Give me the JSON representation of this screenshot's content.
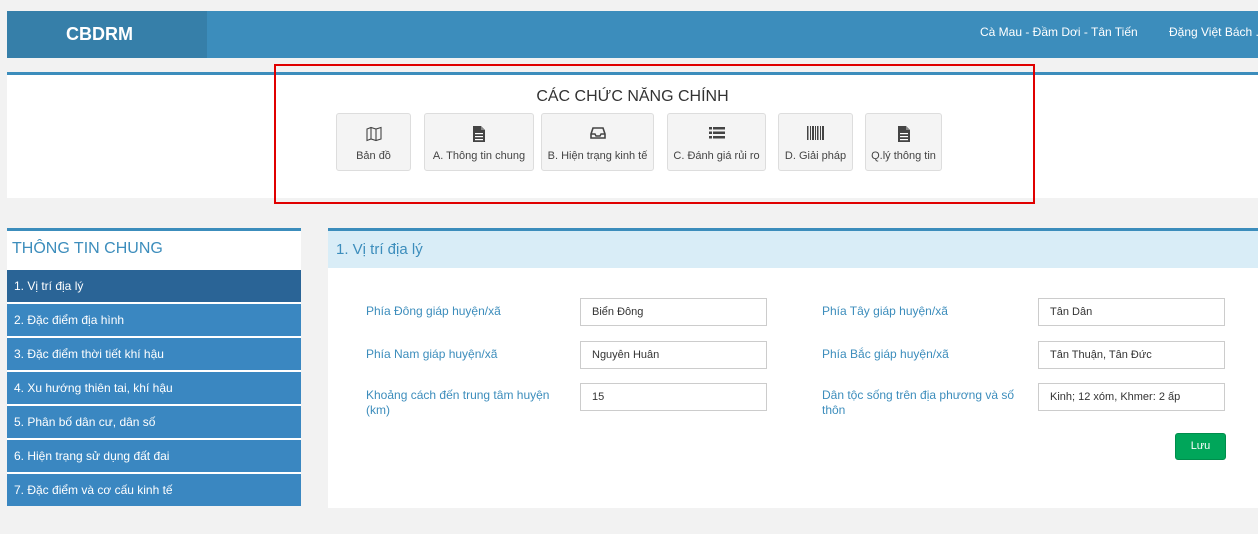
{
  "header": {
    "brand": "CBDRM",
    "location": "Cà Mau - Đầm Dơi - Tân Tiến",
    "user": "Đặng Việt Bách ."
  },
  "functions": {
    "title": "CÁC CHỨC NĂNG CHÍNH",
    "buttons": [
      {
        "label": "Bản đồ",
        "icon": "map-icon"
      },
      {
        "label": "A. Thông tin chung",
        "icon": "document-icon"
      },
      {
        "label": "B. Hiện trạng kinh tế",
        "icon": "inbox-icon"
      },
      {
        "label": "C. Đánh giá rủi ro",
        "icon": "list-icon"
      },
      {
        "label": "D. Giải pháp",
        "icon": "barcode-icon"
      },
      {
        "label": "Q.lý thông tin",
        "icon": "document-icon"
      }
    ]
  },
  "sidebar": {
    "title": "THÔNG TIN CHUNG",
    "items": [
      {
        "label": "1. Vị trí địa lý"
      },
      {
        "label": "2. Đặc điểm địa hình"
      },
      {
        "label": "3. Đặc điểm thời tiết khí hậu"
      },
      {
        "label": "4. Xu hướng thiên tai, khí hậu"
      },
      {
        "label": "5. Phân bố dân cư, dân số"
      },
      {
        "label": "6. Hiện trạng sử dụng đất đai"
      },
      {
        "label": "7. Đặc điểm và cơ cấu kinh tế"
      }
    ]
  },
  "main": {
    "title": "1. Vị trí địa lý",
    "fields": [
      {
        "label": "Phía Đông giáp huyện/xã",
        "value": "Biển Đông"
      },
      {
        "label": "Phía Tây giáp huyện/xã",
        "value": "Tân Dân"
      },
      {
        "label": "Phía Nam giáp huyện/xã",
        "value": "Nguyễn Huân"
      },
      {
        "label": "Phía Bắc giáp huyện/xã",
        "value": "Tân Thuận, Tân Đức"
      },
      {
        "label": "Khoảng cách đến trung tâm huyện (km)",
        "value": "15"
      },
      {
        "label": "Dân tộc sống trên địa phương và số thôn",
        "value": "Kinh; 12 xóm, Khmer: 2 ấp"
      }
    ],
    "save_label": "Lưu"
  },
  "colors": {
    "header": "#3c8dbc",
    "brand_bg": "#367fa9",
    "sidebar_item": "#3a87c1",
    "sidebar_active": "#2a6496",
    "highlight_box": "#e00000",
    "save_button": "#00a65a"
  }
}
